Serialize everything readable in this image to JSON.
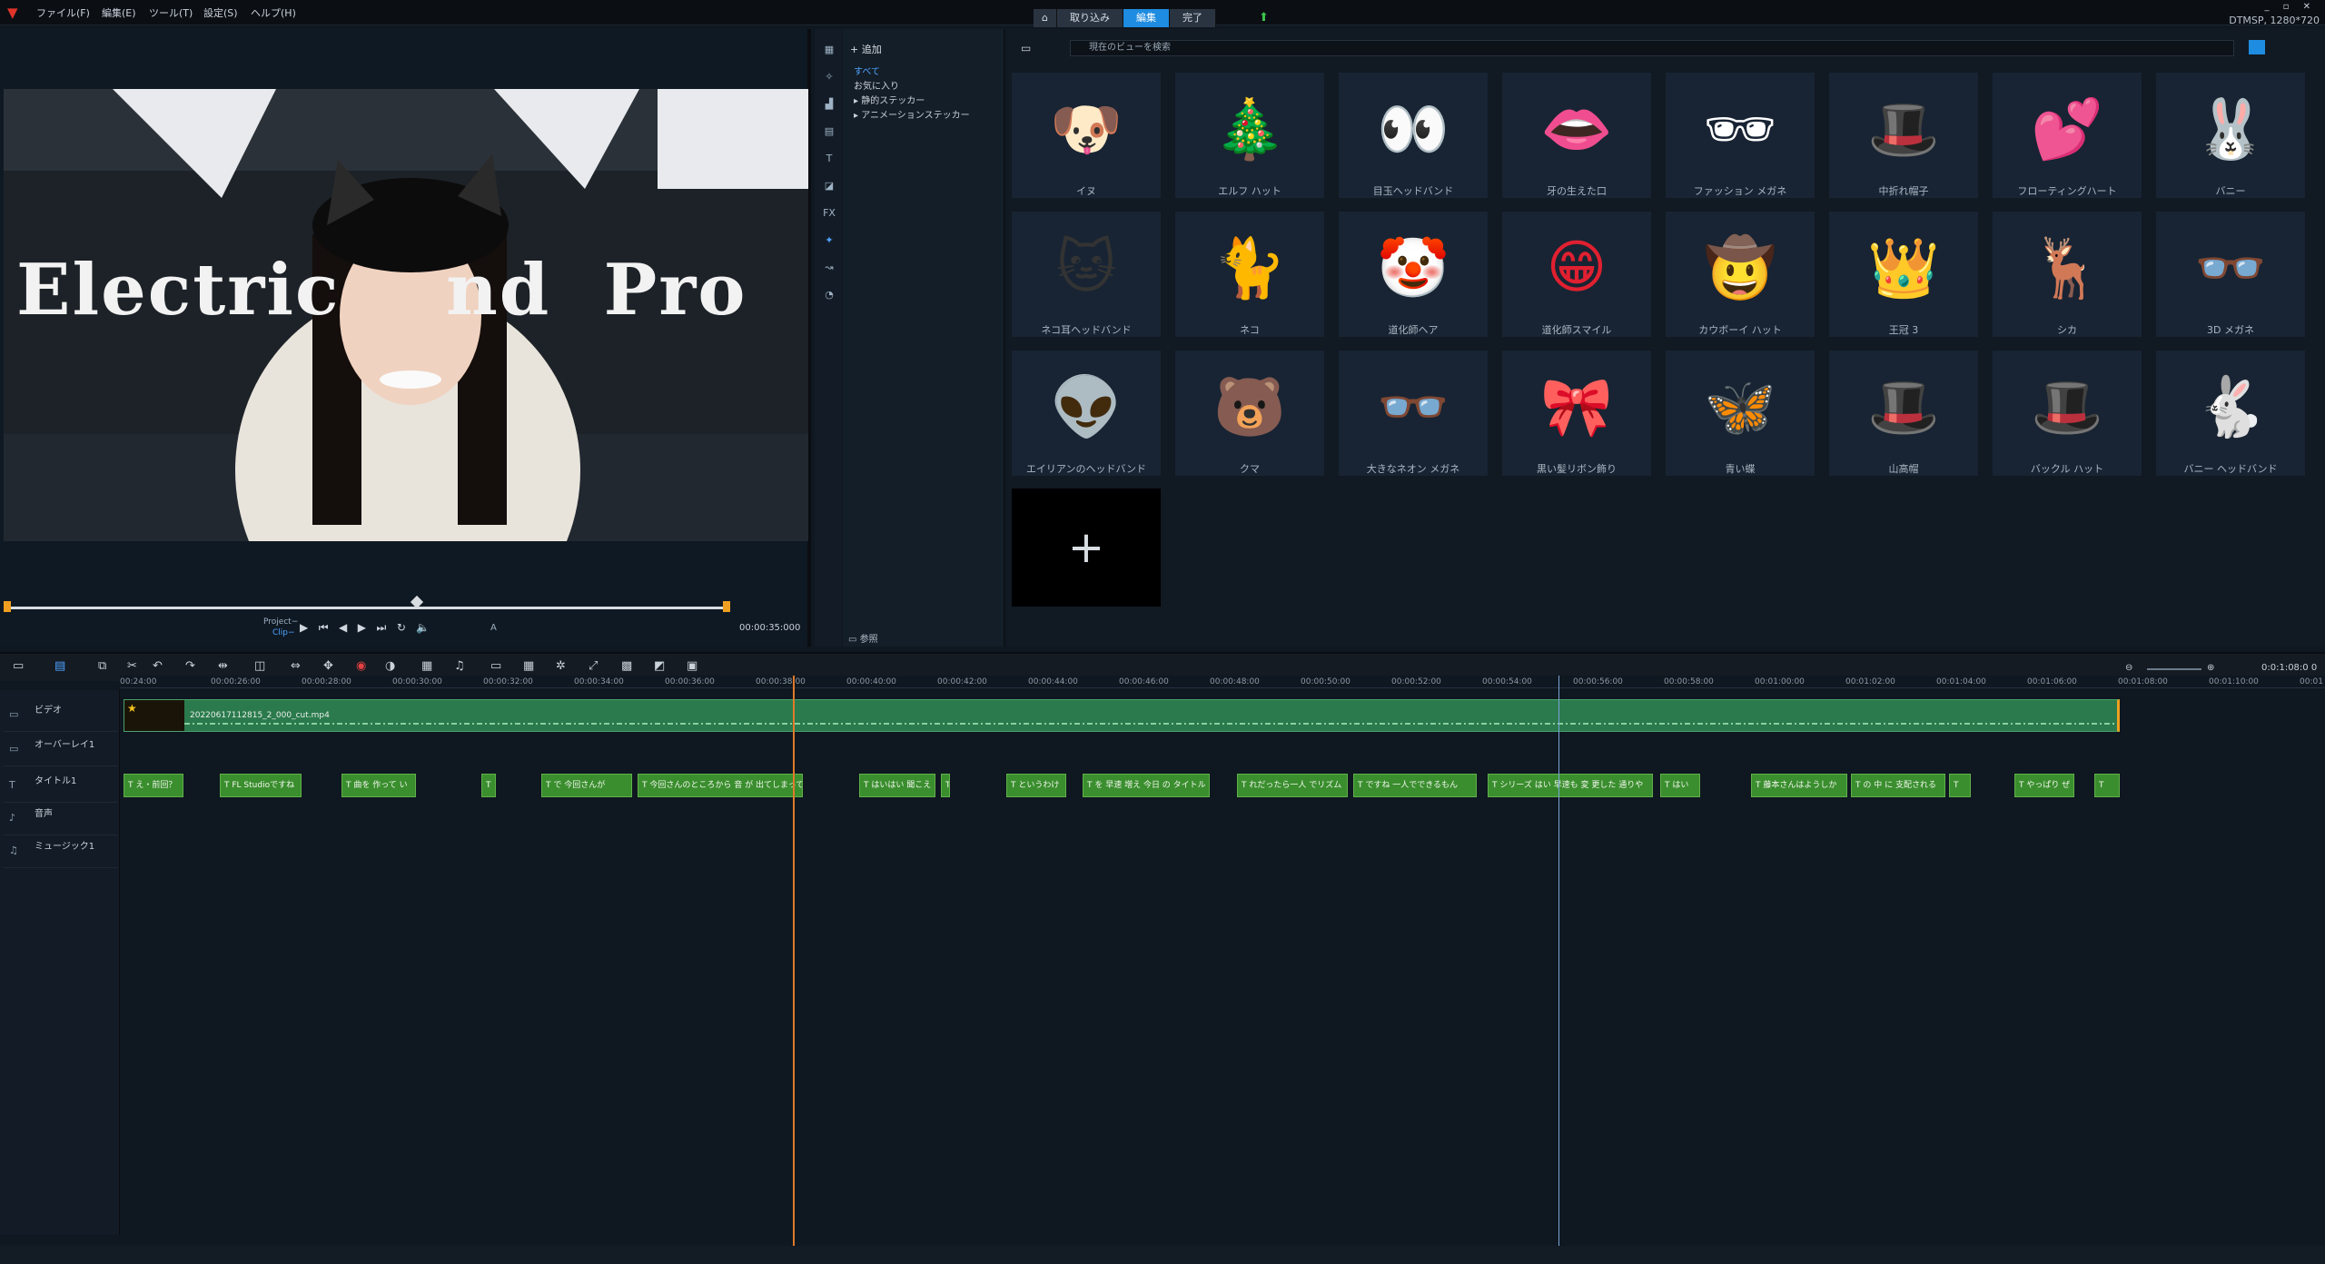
{
  "menubar": {
    "items": [
      "ファイル(F)",
      "編集(E)",
      "ツール(T)",
      "設定(S)",
      "ヘルプ(H)"
    ]
  },
  "mode_tabs": [
    "取り込み",
    "編集",
    "完了"
  ],
  "active_tab": "編集",
  "project_info": "DTMSP, 1280*720",
  "preview": {
    "overlay_text": "Electric    nd  Pro",
    "project_label": "Project−",
    "clip_label": "Clip−",
    "timecode": "00:00:35:000",
    "ab": "A"
  },
  "library": {
    "add_label": "追加",
    "tree": [
      "すべて",
      "お気に入り",
      "静的ステッカー",
      "アニメーションステッカー"
    ],
    "search_placeholder": "現在のビューを検索",
    "browse_label": "参照",
    "stickers": [
      {
        "label": "イヌ",
        "glyph": "🐶",
        "color": "#c8682c"
      },
      {
        "label": "エルフ ハット",
        "glyph": "🎄",
        "color": "#e03030"
      },
      {
        "label": "目玉ヘッドバンド",
        "glyph": "👀",
        "color": "#ff7a20"
      },
      {
        "label": "牙の生えた口",
        "glyph": "👄",
        "color": "#e02020"
      },
      {
        "label": "ファッション メガネ",
        "glyph": "🕶",
        "color": "#ffffff"
      },
      {
        "label": "中折れ帽子",
        "glyph": "🎩",
        "color": "#333333"
      },
      {
        "label": "フローティングハート",
        "glyph": "💕",
        "color": "#f04050"
      },
      {
        "label": "バニー",
        "glyph": "🐰",
        "color": "#f0f0ff"
      },
      {
        "label": "ネコ耳ヘッドバンド",
        "glyph": "🐱",
        "color": "#333333"
      },
      {
        "label": "ネコ",
        "glyph": "🐈",
        "color": "#f0a0b0"
      },
      {
        "label": "道化師ヘア",
        "glyph": "🤡",
        "color": "#f0a010"
      },
      {
        "label": "道化師スマイル",
        "glyph": "😁",
        "color": "#e02030"
      },
      {
        "label": "カウボーイ ハット",
        "glyph": "🤠",
        "color": "#b06a30"
      },
      {
        "label": "王冠 3",
        "glyph": "👑",
        "color": "#f0c020"
      },
      {
        "label": "シカ",
        "glyph": "🦌",
        "color": "#e09080"
      },
      {
        "label": "3D メガネ",
        "glyph": "👓",
        "color": "#4070e0"
      },
      {
        "label": "エイリアンのヘッドバンド",
        "glyph": "👽",
        "color": "#6a3a8a"
      },
      {
        "label": "クマ",
        "glyph": "🐻",
        "color": "#a86040"
      },
      {
        "label": "大きなネオン メガネ",
        "glyph": "👓",
        "color": "#c8e040"
      },
      {
        "label": "黒い髪リボン飾り",
        "glyph": "🎀",
        "color": "#444444"
      },
      {
        "label": "青い蝶",
        "glyph": "🦋",
        "color": "#90c8f0"
      },
      {
        "label": "山高帽",
        "glyph": "🎩",
        "color": "#222222"
      },
      {
        "label": "バックル ハット",
        "glyph": "🎩",
        "color": "#6a4030"
      },
      {
        "label": "バニー ヘッドバンド",
        "glyph": "🐇",
        "color": "#f0f0f0"
      }
    ]
  },
  "timeline": {
    "ticks": [
      "00:24:00",
      "00:00:26:00",
      "00:00:28:00",
      "00:00:30:00",
      "00:00:32:00",
      "00:00:34:00",
      "00:00:36:00",
      "00:00:38:00",
      "00:00:40:00",
      "00:00:42:00",
      "00:00:44:00",
      "00:00:46:00",
      "00:00:48:00",
      "00:00:50:00",
      "00:00:52:00",
      "00:00:54:00",
      "00:00:56:00",
      "00:00:58:00",
      "00:01:00:00",
      "00:01:02:00",
      "00:01:04:00",
      "00:01:06:00",
      "00:01:08:00",
      "00:01:10:00",
      "00:01"
    ],
    "tracks": [
      "ビデオ",
      "オーバーレイ1",
      "タイトル1",
      "音声",
      "ミュージック1"
    ],
    "video_clip": "20220617112815_2_000_cut.mp4",
    "title_clips": [
      "え・前回？",
      "FL Studioですね",
      "曲を 作って い",
      "",
      "で 今回さんが",
      "今回さんのところから 音 が 出てしまって",
      "はいはい 聞こえ",
      "",
      "というわけ",
      "を 早速 増え 今日 の タイトル",
      "れだったら一人 でリズム",
      "ですね 一人でできるもん",
      "シリーズ はい 早速も 変 更した 通りや",
      "はい",
      "藤本さんはようしか",
      "の 中 に 支配される",
      "",
      "やっぱり ぜ",
      ""
    ],
    "zoom": "0:0:1:08:0 0"
  }
}
